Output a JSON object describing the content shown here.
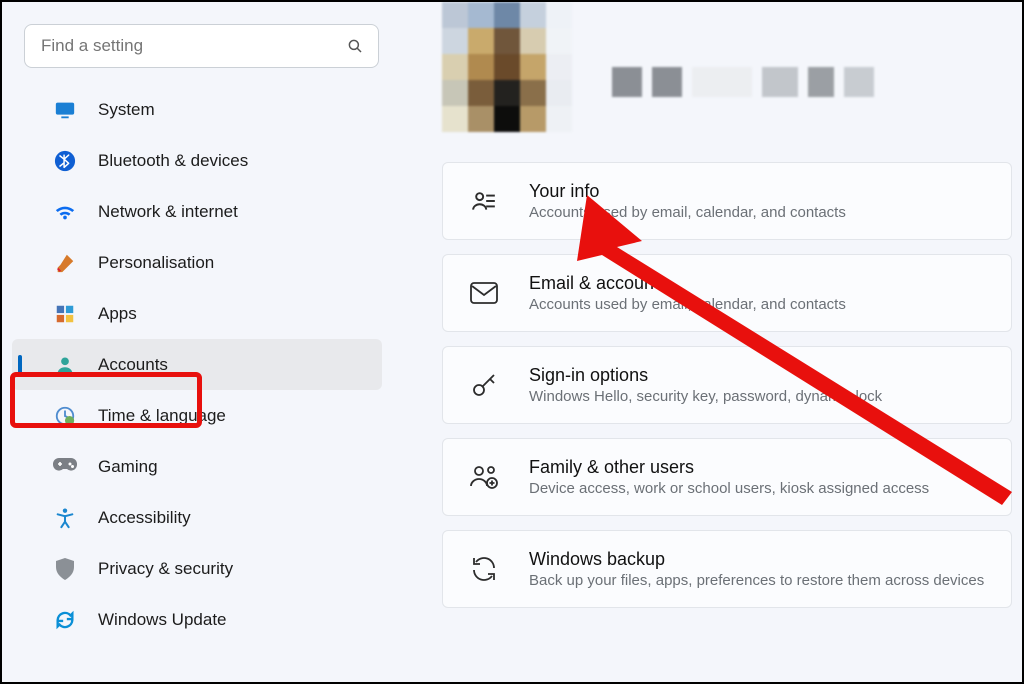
{
  "search": {
    "placeholder": "Find a setting"
  },
  "nav": {
    "items": [
      {
        "label": "System",
        "icon": "monitor-icon",
        "color": "#1a7fd4"
      },
      {
        "label": "Bluetooth & devices",
        "icon": "bluetooth-icon",
        "color": "#0f5fd3"
      },
      {
        "label": "Network & internet",
        "icon": "wifi-icon",
        "color": "#0b6cf0"
      },
      {
        "label": "Personalisation",
        "icon": "brush-icon",
        "color": "#d77a2a"
      },
      {
        "label": "Apps",
        "icon": "apps-icon",
        "color": "#4574b7"
      },
      {
        "label": "Accounts",
        "icon": "person-icon",
        "color": "#2ea49a"
      },
      {
        "label": "Time & language",
        "icon": "clock-globe-icon",
        "color": "#4f8ccf"
      },
      {
        "label": "Gaming",
        "icon": "gamepad-icon",
        "color": "#7b7f85"
      },
      {
        "label": "Accessibility",
        "icon": "accessibility-icon",
        "color": "#1b87cf"
      },
      {
        "label": "Privacy & security",
        "icon": "shield-icon",
        "color": "#8b9096"
      },
      {
        "label": "Windows Update",
        "icon": "update-icon",
        "color": "#0a8fd6"
      }
    ],
    "active_index": 5
  },
  "cards": [
    {
      "title": "Your info",
      "sub": "Accounts used by email, calendar, and contacts",
      "icon": "person-lines-icon"
    },
    {
      "title": "Email & accounts",
      "sub": "Accounts used by email, calendar, and contacts",
      "icon": "mail-icon"
    },
    {
      "title": "Sign-in options",
      "sub": "Windows Hello, security key, password, dynamic lock",
      "icon": "key-icon"
    },
    {
      "title": "Family & other users",
      "sub": "Device access, work or school users, kiosk assigned access",
      "icon": "people-add-icon"
    },
    {
      "title": "Windows backup",
      "sub": "Back up your files, apps, preferences to restore them across devices",
      "icon": "backup-icon"
    }
  ],
  "annotation": {
    "highlight_nav_index": 5,
    "arrow_points_to_card_index": 0
  }
}
